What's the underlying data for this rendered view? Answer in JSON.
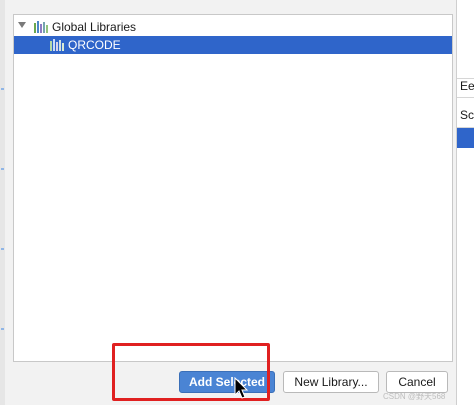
{
  "tree": {
    "root_label": "Global Libraries",
    "root_icon": "library-icon",
    "expander_icon": "triangle-down-icon",
    "items": [
      {
        "label": "QRCODE",
        "icon": "library-icon",
        "selected": true
      }
    ]
  },
  "buttons": {
    "add_selected": "Add Selected",
    "new_library": "New Library...",
    "cancel": "Cancel"
  },
  "right_panel": {
    "cell_a": "Ee",
    "cell_b": "Sc"
  },
  "watermark": "CSDN @野天568",
  "colors": {
    "selection": "#2f65ca",
    "primary_button": "#4a84d4",
    "highlight": "#e02020"
  }
}
